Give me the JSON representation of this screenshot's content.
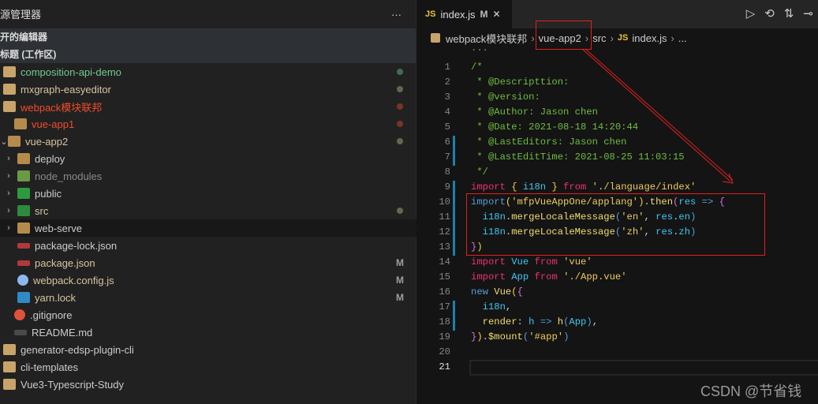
{
  "sidebar": {
    "title": "源管理器",
    "more": "···",
    "sections": [
      "开的编辑器",
      "标题 (工作区)"
    ],
    "items": [
      {
        "label": "composition-api-demo",
        "level": 0,
        "icon": "root-folder-icon",
        "color": "#73c991",
        "dot": "#3f6e4f",
        "chev": ""
      },
      {
        "label": "mxgraph-easyeditor",
        "level": 0,
        "icon": "root-folder-icon",
        "color": "#d7c4a0",
        "dot": "#6b6253",
        "chev": ""
      },
      {
        "label": "webpack模块联邦",
        "level": 0,
        "icon": "root-folder-open-icon",
        "color": "#f14c2c",
        "dot": "#7a3325",
        "chev": ""
      },
      {
        "label": "vue-app1",
        "level": 1,
        "icon": "folder-icon",
        "color": "#f14c2c",
        "dot": "#7a3325",
        "chev": ""
      },
      {
        "label": "vue-app2",
        "level": 1,
        "icon": "folder-open-icon",
        "color": "#d7c4a0",
        "dot": "#6b6253",
        "chev": "⌄"
      },
      {
        "label": "deploy",
        "level": 2,
        "icon": "folder-icon",
        "color": "#ccc",
        "chev": "›"
      },
      {
        "label": "node_modules",
        "level": 2,
        "icon": "node-folder-icon",
        "color": "#8a8a8a",
        "chev": "›"
      },
      {
        "label": "public",
        "level": 2,
        "icon": "public-folder-icon",
        "color": "#ccc",
        "chev": "›"
      },
      {
        "label": "src",
        "level": 2,
        "icon": "src-folder-icon",
        "color": "#d7c4a0",
        "dot": "#6b6253",
        "chev": "›"
      },
      {
        "label": "web-serve",
        "level": 2,
        "icon": "folder-icon",
        "color": "#ccc",
        "chev": "›",
        "hl": true
      },
      {
        "label": "package-lock.json",
        "level": 2,
        "icon": "npm-icon",
        "color": "#ccc",
        "chev": " "
      },
      {
        "label": "package.json",
        "level": 2,
        "icon": "npm-icon",
        "color": "#d7c4a0",
        "badge": "M",
        "chev": " "
      },
      {
        "label": "webpack.config.js",
        "level": 2,
        "icon": "webpack-icon",
        "color": "#d7c4a0",
        "badge": "M",
        "chev": " "
      },
      {
        "label": "yarn.lock",
        "level": 2,
        "icon": "yarn-icon",
        "color": "#d7c4a0",
        "badge": "M",
        "chev": " "
      },
      {
        "label": ".gitignore",
        "level": 1,
        "icon": "git-icon",
        "color": "#ccc",
        "chev": ""
      },
      {
        "label": "README.md",
        "level": 1,
        "icon": "markdown-icon",
        "color": "#ccc",
        "chev": ""
      },
      {
        "label": "generator-edsp-plugin-cli",
        "level": 0,
        "icon": "root-folder-icon",
        "color": "#ccc",
        "chev": ""
      },
      {
        "label": "cli-templates",
        "level": 0,
        "icon": "root-folder-icon",
        "color": "#ccc",
        "chev": ""
      },
      {
        "label": "Vue3-Typescript-Study",
        "level": 0,
        "icon": "root-folder-icon",
        "color": "#ccc",
        "chev": ""
      }
    ]
  },
  "tab": {
    "icon": "JS",
    "label": "index.js",
    "status": "M",
    "close": "✕"
  },
  "actions": [
    "▷",
    "⟲",
    "⇅",
    "⊸"
  ],
  "breadcrumb": [
    "webpack模块联邦",
    "vue-app2",
    "src",
    "index.js",
    "..."
  ],
  "fold_hint": "...",
  "code": [
    [
      [
        "/*",
        "c"
      ]
    ],
    [
      [
        " * @Descripttion:",
        "c"
      ]
    ],
    [
      [
        " * @version:",
        "c"
      ]
    ],
    [
      [
        " * @Author: Jason chen",
        "c"
      ]
    ],
    [
      [
        " * @Date: 2021-08-18 14:20:44",
        "c"
      ]
    ],
    [
      [
        " * @LastEditors: Jason chen",
        "c"
      ]
    ],
    [
      [
        " * @LastEditTime: 2021-08-25 11:03:15",
        "c"
      ]
    ],
    [
      [
        " */",
        "c"
      ]
    ],
    [
      [
        "import",
        "k"
      ],
      [
        " ",
        "w"
      ],
      [
        "{",
        "y"
      ],
      [
        " i18n ",
        "v"
      ],
      [
        "}",
        "y"
      ],
      [
        " ",
        "w"
      ],
      [
        "from",
        "k"
      ],
      [
        " './language/index'",
        "s"
      ]
    ],
    [
      [
        "import",
        "b"
      ],
      [
        "(",
        "y"
      ],
      [
        "'mfpVueAppOne/applang'",
        "s"
      ],
      [
        ")",
        "y"
      ],
      [
        ".",
        "w"
      ],
      [
        "then",
        "f"
      ],
      [
        "(",
        "p"
      ],
      [
        "res",
        "v"
      ],
      [
        " => ",
        "b"
      ],
      [
        "{",
        "p"
      ]
    ],
    [
      [
        "  ",
        "w"
      ],
      [
        "i18n",
        "v"
      ],
      [
        ".",
        "w"
      ],
      [
        "mergeLocaleMessage",
        "f"
      ],
      [
        "(",
        "b"
      ],
      [
        "'en'",
        "s"
      ],
      [
        ", ",
        "w"
      ],
      [
        "res",
        "v"
      ],
      [
        ".",
        "w"
      ],
      [
        "en",
        "v"
      ],
      [
        ")",
        "b"
      ]
    ],
    [
      [
        "  ",
        "w"
      ],
      [
        "i18n",
        "v"
      ],
      [
        ".",
        "w"
      ],
      [
        "mergeLocaleMessage",
        "f"
      ],
      [
        "(",
        "b"
      ],
      [
        "'zh'",
        "s"
      ],
      [
        ", ",
        "w"
      ],
      [
        "res",
        "v"
      ],
      [
        ".",
        "w"
      ],
      [
        "zh",
        "v"
      ],
      [
        ")",
        "b"
      ]
    ],
    [
      [
        "}",
        "p"
      ],
      [
        ")",
        "y"
      ]
    ],
    [
      [
        "import",
        "k"
      ],
      [
        " ",
        "w"
      ],
      [
        "Vue",
        "v"
      ],
      [
        " ",
        "w"
      ],
      [
        "from",
        "k"
      ],
      [
        " 'vue'",
        "s"
      ]
    ],
    [
      [
        "import",
        "k"
      ],
      [
        " ",
        "w"
      ],
      [
        "App",
        "v"
      ],
      [
        " ",
        "w"
      ],
      [
        "from",
        "k"
      ],
      [
        " './App.vue'",
        "s"
      ]
    ],
    [
      [
        "new",
        "b"
      ],
      [
        " ",
        "w"
      ],
      [
        "Vue",
        "f"
      ],
      [
        "(",
        "y"
      ],
      [
        "{",
        "p"
      ]
    ],
    [
      [
        "  ",
        "w"
      ],
      [
        "i18n",
        "v"
      ],
      [
        ",",
        "w"
      ]
    ],
    [
      [
        "  ",
        "w"
      ],
      [
        "render",
        "f"
      ],
      [
        ": ",
        "w"
      ],
      [
        "h",
        "v"
      ],
      [
        " => ",
        "b"
      ],
      [
        "h",
        "f"
      ],
      [
        "(",
        "b"
      ],
      [
        "App",
        "v"
      ],
      [
        ")",
        "b"
      ],
      [
        ",",
        "w"
      ]
    ],
    [
      [
        "}",
        "p"
      ],
      [
        ")",
        "y"
      ],
      [
        ".",
        "w"
      ],
      [
        "$mount",
        "f"
      ],
      [
        "(",
        "b"
      ],
      [
        "'#app'",
        "s"
      ],
      [
        ")",
        "b"
      ]
    ],
    [],
    []
  ],
  "modified_lines": [
    6,
    7,
    9,
    10,
    11,
    12,
    13,
    17,
    18
  ],
  "watermark": "CSDN @节省钱",
  "colors": {
    "annotation": "#e02020"
  }
}
